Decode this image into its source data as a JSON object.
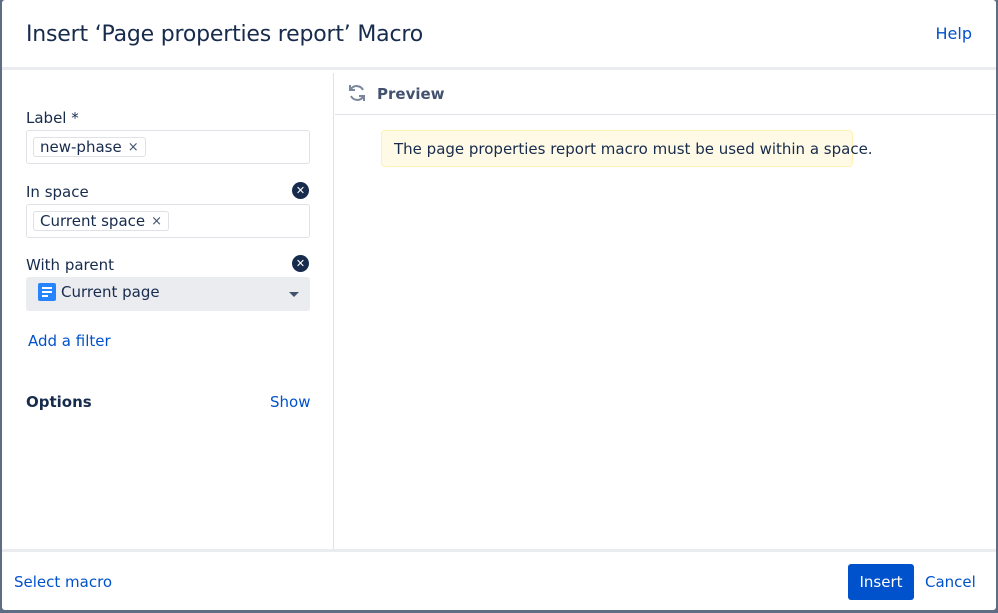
{
  "dialog": {
    "title": "Insert ‘Page properties report’ Macro",
    "help_label": "Help"
  },
  "form": {
    "label_field": {
      "label": "Label *",
      "chips": [
        {
          "text": "new-phase",
          "remove_icon": "×"
        }
      ]
    },
    "space_field": {
      "label": "In space",
      "clear_icon": "✕",
      "chips": [
        {
          "text": "Current space",
          "remove_icon": "×"
        }
      ]
    },
    "parent_field": {
      "label": "With parent",
      "clear_icon": "✕",
      "icon": "page-icon",
      "selected": "Current page"
    },
    "add_filter_label": "Add a filter",
    "options": {
      "title": "Options",
      "toggle_label": "Show"
    }
  },
  "preview": {
    "label": "Preview",
    "refresh_icon": "refresh-icon",
    "message": "The page properties report macro must be used within a space."
  },
  "footer": {
    "select_macro_label": "Select macro",
    "insert_label": "Insert",
    "cancel_label": "Cancel"
  },
  "colors": {
    "primary": "#0052cc",
    "link": "#0052cc",
    "text": "#172b4d",
    "warning_bg": "#fffae6",
    "page_icon": "#2684ff"
  }
}
